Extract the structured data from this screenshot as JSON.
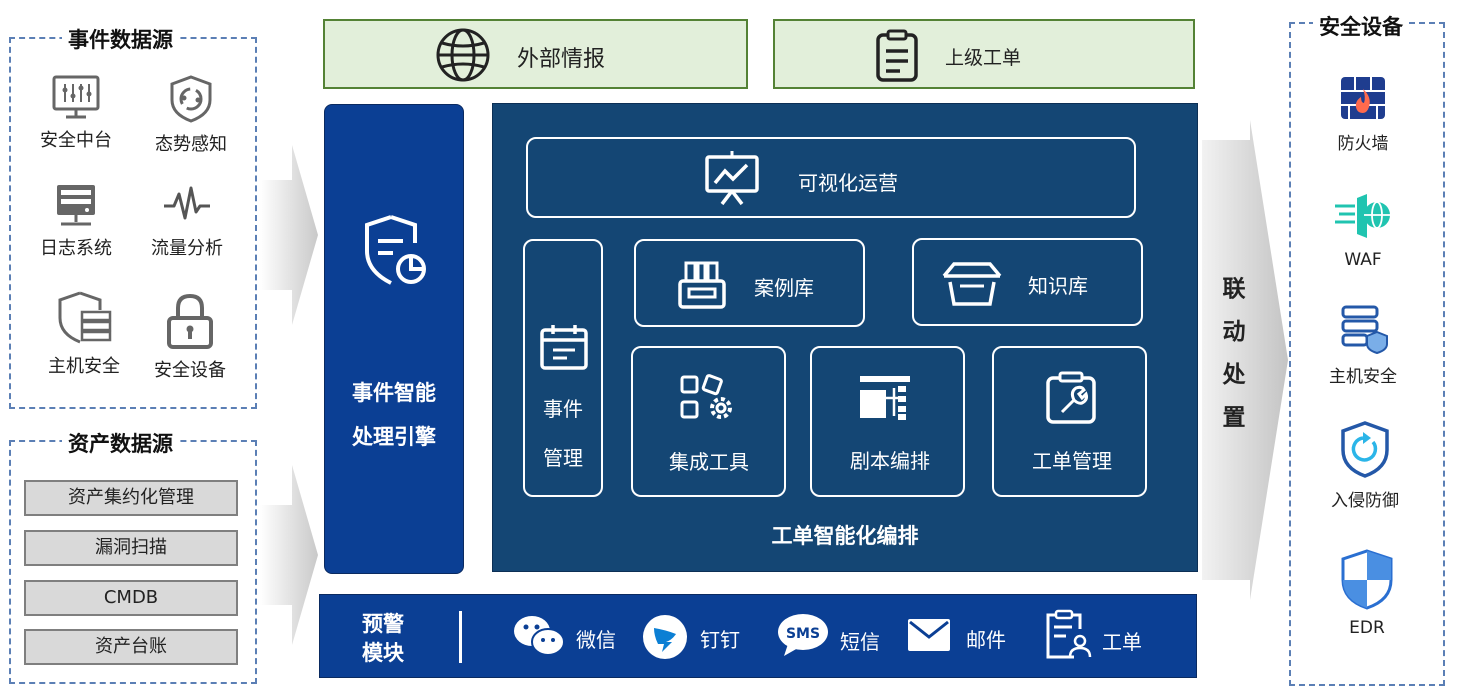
{
  "event_sources": {
    "title": "事件数据源",
    "items": [
      {
        "label": "安全中台",
        "icon": "dashboard-monitor-icon"
      },
      {
        "label": "态势感知",
        "icon": "shield-cycle-icon"
      },
      {
        "label": "日志系统",
        "icon": "server-icon"
      },
      {
        "label": "流量分析",
        "icon": "pulse-icon"
      },
      {
        "label": "主机安全",
        "icon": "shield-server-icon"
      },
      {
        "label": "安全设备",
        "icon": "lock-icon"
      }
    ]
  },
  "asset_sources": {
    "title": "资产数据源",
    "items": [
      "资产集约化管理",
      "漏洞扫描",
      "CMDB",
      "资产台账"
    ]
  },
  "top": {
    "external_intel": "外部情报",
    "superior_ticket": "上级工单"
  },
  "engine": {
    "line1": "事件智能",
    "line2": "处理引擎"
  },
  "panel": {
    "visual_ops": "可视化运营",
    "event_mgmt_line1": "事件",
    "event_mgmt_line2": "管理",
    "case_lib": "案例库",
    "knowledge_lib": "知识库",
    "integration_tools": "集成工具",
    "playbook": "剧本编排",
    "ticket_mgmt": "工单管理",
    "footer": "工单智能化编排"
  },
  "alert": {
    "title_line1": "预警",
    "title_line2": "模块",
    "channels": [
      "微信",
      "钉钉",
      "短信",
      "邮件",
      "工单"
    ]
  },
  "linkage": [
    "联",
    "动",
    "处",
    "置"
  ],
  "security_devices": {
    "title": "安全设备",
    "items": [
      {
        "label": "防火墙",
        "icon": "firewall-icon"
      },
      {
        "label": "WAF",
        "icon": "waf-globe-icon"
      },
      {
        "label": "主机安全",
        "icon": "host-security-icon"
      },
      {
        "label": "入侵防御",
        "icon": "intrusion-defense-icon"
      },
      {
        "label": "EDR",
        "icon": "edr-shield-icon"
      }
    ]
  },
  "colors": {
    "panel_blue": "#144674",
    "engine_blue": "#0b3f94",
    "green_fill": "#e2efda",
    "green_border": "#548235",
    "dash_border": "#5b7fb5"
  }
}
